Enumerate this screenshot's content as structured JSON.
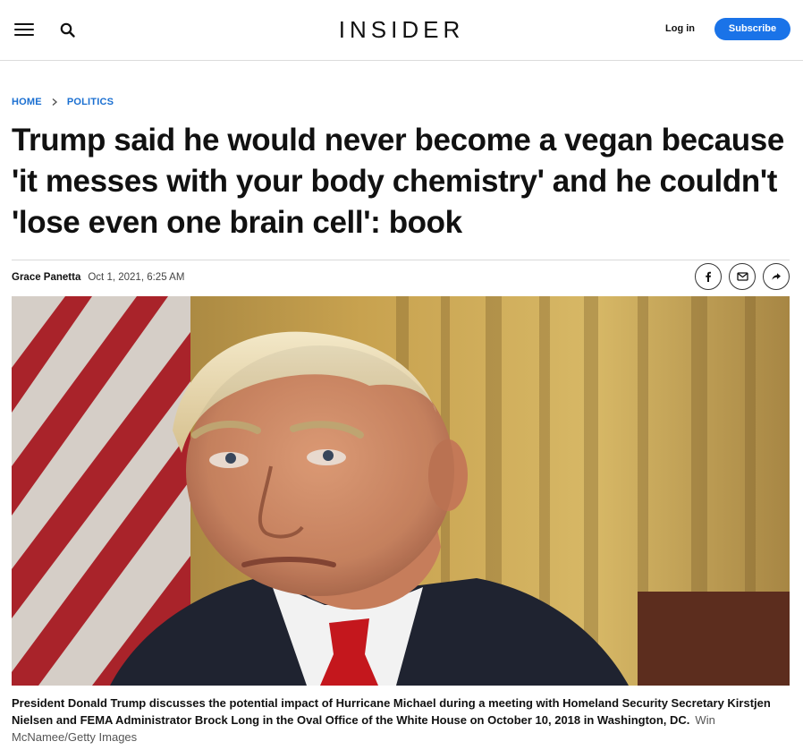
{
  "header": {
    "logo": "INSIDER",
    "login_label": "Log in",
    "subscribe_label": "Subscribe"
  },
  "breadcrumb": {
    "home": "HOME",
    "section": "POLITICS"
  },
  "article": {
    "headline": "Trump said he would never become a vegan because 'it messes with your body chemistry' and he couldn't 'lose even one brain cell': book",
    "author": "Grace Panetta",
    "date": "Oct 1, 2021, 6:25 AM"
  },
  "share": {
    "icons": [
      "facebook-icon",
      "email-icon",
      "share-icon"
    ]
  },
  "image": {
    "caption": "President Donald Trump discusses the potential impact of Hurricane Michael during a meeting with Homeland Security Secretary Kirstjen Nielsen and FEMA Administrator Brock Long in the Oval Office of the White House on October 10, 2018 in Washington, DC.",
    "credit": "Win McNamee/Getty Images"
  },
  "colors": {
    "accent": "#1a73e8",
    "link": "#1a6fd1"
  }
}
